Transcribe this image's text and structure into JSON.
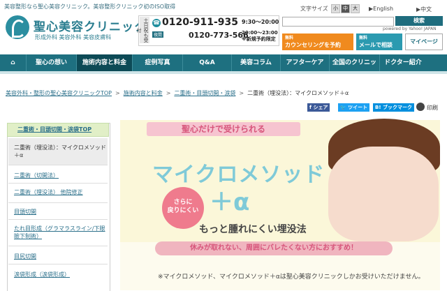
{
  "header": {
    "tagline": "美容整形なら聖心美容クリニック。美容整形クリニック初のISO取得",
    "logo_name": "聖心美容クリニック",
    "logo_sub": "形成外科 美容外科 美容皮膚科",
    "phone_side": "土日祝も受付",
    "tel_main": "0120-911-935",
    "tel_main_hours": "9:30〜20:00",
    "tel_night_badge": "夜間",
    "tel_night": "0120-773-566",
    "tel_night_hours": [
      "20:00〜23:00",
      "※新規予約限定"
    ],
    "font_size_label": "文字サイズ",
    "font_sizes": [
      "小",
      "中",
      "大"
    ],
    "langs": [
      "▶English",
      "▶中文"
    ],
    "search_placeholder": "",
    "search_button": "検索",
    "powered_by": "powered by Yahoo! JAPAN",
    "cta_counsel_small": "無料",
    "cta_counsel": "カウンセリングを予約",
    "cta_mail_small": "無料",
    "cta_mail": "メールで相談",
    "cta_mypage": "マイページ"
  },
  "nav": {
    "items": [
      "聖心の想い",
      "施術内容と料金",
      "症例写真",
      "Q&A",
      "美容コラム",
      "アフターケア",
      "全国のクリニック",
      "ドクター紹介"
    ],
    "active_index": 1
  },
  "breadcrumb": {
    "items": [
      "美容外科・整形の聖心美容クリニックTOP",
      "施術内容と料金",
      "二重術・目頭切開・涙袋",
      "二重術（埋没法）：マイクロメソッド＋α"
    ]
  },
  "share": {
    "facebook": "シェア",
    "twitter": "ツイート",
    "hatena": "ブックマーク",
    "print": "印刷"
  },
  "sidebar": {
    "head": "二重術・目頭切開・涙袋TOP",
    "items": [
      "二重術（埋没法）：マイクロメソッド＋α",
      "二重術（切開法）",
      "二重術（埋没法） 他院修正",
      "目頭切開",
      "たれ目形成（グラマラスライン/下眼瞼下制術）",
      "目尻切開",
      "涙袋形成（涙袋形成）"
    ]
  },
  "banner": {
    "ribbon": "聖心だけで受けられる",
    "title": "マイクロメソッド",
    "plus": "＋α",
    "circle": [
      "さらに",
      "戻りにくい"
    ],
    "subline": "もっと腫れにくい埋没法",
    "pinkbar": "休みが取れない、周囲にバレたくない方におすすめ！",
    "note": "※マイクロメソッド、マイクロメソッド＋αは聖心美容クリニックしかお受けいただけません。"
  },
  "colors": {
    "teal": "#1e7080",
    "orange": "#f08a1e",
    "pink": "#ef7b8d",
    "sidebar_green": "#e1efc7"
  }
}
